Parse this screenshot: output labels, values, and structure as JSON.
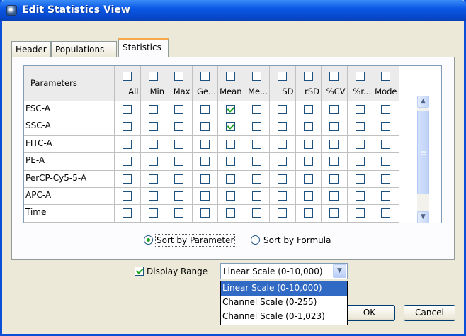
{
  "window": {
    "title": "Edit Statistics View"
  },
  "tabs": [
    {
      "label": "Header",
      "active": false
    },
    {
      "label": "Populations",
      "active": false
    },
    {
      "label": "Statistics",
      "active": true
    }
  ],
  "grid": {
    "params_header": "Parameters",
    "columns": [
      "All",
      "Min",
      "Max",
      "Ge...",
      "Mean",
      "Me...",
      "SD",
      "rSD",
      "%CV",
      "%r...",
      "Mode"
    ],
    "rows": [
      {
        "name": "FSC-A",
        "checked": [
          false,
          false,
          false,
          false,
          true,
          false,
          false,
          false,
          false,
          false,
          false
        ]
      },
      {
        "name": "SSC-A",
        "checked": [
          false,
          false,
          false,
          false,
          true,
          false,
          false,
          false,
          false,
          false,
          false
        ]
      },
      {
        "name": "FITC-A",
        "checked": [
          false,
          false,
          false,
          false,
          false,
          false,
          false,
          false,
          false,
          false,
          false
        ]
      },
      {
        "name": "PE-A",
        "checked": [
          false,
          false,
          false,
          false,
          false,
          false,
          false,
          false,
          false,
          false,
          false
        ]
      },
      {
        "name": "PerCP-Cy5-5-A",
        "checked": [
          false,
          false,
          false,
          false,
          false,
          false,
          false,
          false,
          false,
          false,
          false
        ]
      },
      {
        "name": "APC-A",
        "checked": [
          false,
          false,
          false,
          false,
          false,
          false,
          false,
          false,
          false,
          false,
          false
        ]
      },
      {
        "name": "Time",
        "checked": [
          false,
          false,
          false,
          false,
          false,
          false,
          false,
          false,
          false,
          false,
          false
        ]
      }
    ]
  },
  "sort": {
    "by_parameter": "Sort by Parameter",
    "by_formula": "Sort by Formula",
    "selected": "by_parameter"
  },
  "display_range": {
    "label": "Display Range",
    "checked": true,
    "selected": "Linear Scale (0-10,000)",
    "options": [
      "Linear Scale (0-10,000)",
      "Channel Scale (0-255)",
      "Channel Scale (0-1,023)"
    ]
  },
  "buttons": {
    "ok": "OK",
    "cancel": "Cancel"
  },
  "icons": {
    "scroll_up": "chevron-up-icon",
    "scroll_down": "chevron-down-icon",
    "combo": "chevron-down-icon"
  }
}
